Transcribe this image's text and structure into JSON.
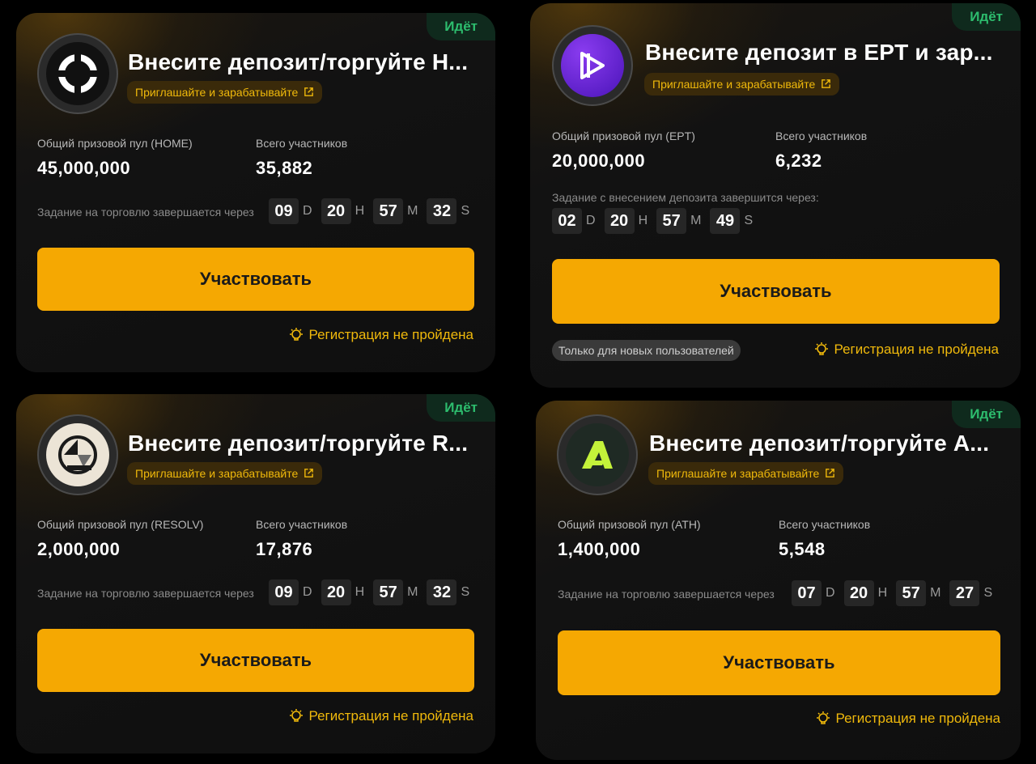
{
  "cards": [
    {
      "status": "Идёт",
      "title": "Внесите депозит/торгуйте H...",
      "invite_label": "Приглашайте и зарабатывайте",
      "pool_label": "Общий призовой пул (HOME)",
      "pool_value": "45,000,000",
      "participants_label": "Всего участников",
      "participants_value": "35,882",
      "timer_label": "Задание на торговлю завершается через",
      "timer": {
        "d": "09",
        "h": "20",
        "m": "57",
        "s": "32"
      },
      "units": {
        "d": "D",
        "h": "H",
        "m": "M",
        "s": "S"
      },
      "button_label": "Участвовать",
      "registration_text": "Регистрация не пройдена",
      "logo_icon": "home-logo-icon"
    },
    {
      "status": "Идёт",
      "title": "Внесите депозит в EPT и зар...",
      "invite_label": "Приглашайте и зарабатывайте",
      "pool_label": "Общий призовой пул (EPT)",
      "pool_value": "20,000,000",
      "participants_label": "Всего участников",
      "participants_value": "6,232",
      "timer_label": "Задание с внесением депозита завершится через:",
      "timer": {
        "d": "02",
        "h": "20",
        "m": "57",
        "s": "49"
      },
      "units": {
        "d": "D",
        "h": "H",
        "m": "M",
        "s": "S"
      },
      "button_label": "Участвовать",
      "new_users_badge": "Только для новых пользователей",
      "registration_text": "Регистрация не пройдена",
      "logo_icon": "ept-logo-icon"
    },
    {
      "status": "Идёт",
      "title": "Внесите депозит/торгуйте R...",
      "invite_label": "Приглашайте и зарабатывайте",
      "pool_label": "Общий призовой пул (RESOLV)",
      "pool_value": "2,000,000",
      "participants_label": "Всего участников",
      "participants_value": "17,876",
      "timer_label": "Задание на торговлю завершается через",
      "timer": {
        "d": "09",
        "h": "20",
        "m": "57",
        "s": "32"
      },
      "units": {
        "d": "D",
        "h": "H",
        "m": "M",
        "s": "S"
      },
      "button_label": "Участвовать",
      "registration_text": "Регистрация не пройдена",
      "logo_icon": "resolv-logo-icon"
    },
    {
      "status": "Идёт",
      "title": "Внесите депозит/торгуйте A...",
      "invite_label": "Приглашайте и зарабатывайте",
      "pool_label": "Общий призовой пул (ATH)",
      "pool_value": "1,400,000",
      "participants_label": "Всего участников",
      "participants_value": "5,548",
      "timer_label": "Задание на торговлю завершается через",
      "timer": {
        "d": "07",
        "h": "20",
        "m": "57",
        "s": "27"
      },
      "units": {
        "d": "D",
        "h": "H",
        "m": "M",
        "s": "S"
      },
      "button_label": "Участвовать",
      "registration_text": "Регистрация не пройдена",
      "logo_icon": "ath-logo-icon"
    }
  ],
  "colors": {
    "accent": "#f5a802",
    "status_green": "#2dbd6e",
    "card_bg": "#121212"
  }
}
